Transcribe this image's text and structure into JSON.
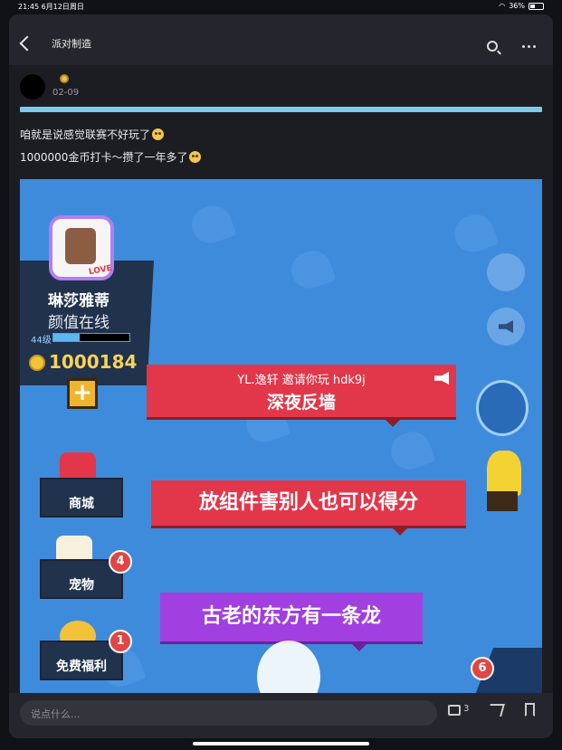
{
  "status": {
    "time_date": "21:45  6月12日周日",
    "battery": "36%"
  },
  "nav": {
    "title": "派对制造"
  },
  "post": {
    "date": "02-09",
    "line1": "咱就是说感觉联赛不好玩了",
    "line2": "1000000金币打卡～攒了一年多了"
  },
  "game": {
    "player_name": "琳莎雅蒂",
    "player_title": "颜值在线",
    "level": "44级",
    "level_progress": 0.35,
    "coins": "1000184",
    "invite_text": "YL.逸轩 邀请你玩 hdk9j",
    "invite_room": "深夜反墙",
    "banner2": "放组件害别人也可以得分",
    "banner3": "古老的东方有一条龙",
    "menu": [
      {
        "label": "商城",
        "count": ""
      },
      {
        "label": "宠物",
        "count": "4"
      },
      {
        "label": "免费福利",
        "count": "1"
      }
    ],
    "bottom_count": "6",
    "photo_badge": "LOVE"
  },
  "footer": {
    "comment_placeholder": "说点什么...",
    "comment_count": "3"
  }
}
